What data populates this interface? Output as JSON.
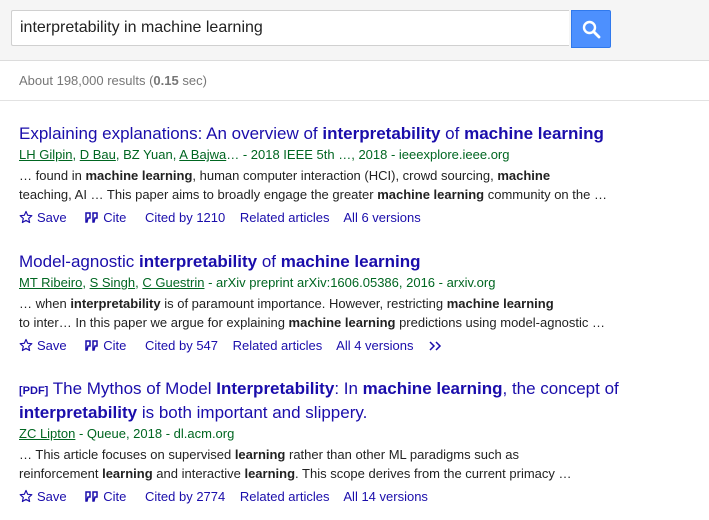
{
  "search": {
    "query": "interpretability in machine learning"
  },
  "stats": {
    "prefix": "About 198,000 results (",
    "time": "0.15",
    "suffix": " sec)"
  },
  "actions": {
    "save_label": "Save",
    "cite_label": "Cite",
    "related_label": "Related articles"
  },
  "results": [
    {
      "title_parts": [
        "Explaining explanations: An overview of ",
        "interpretability",
        " of ",
        "machine learning"
      ],
      "authors": [
        "LH Gilpin",
        "D Bau",
        "BZ Yuan",
        "A Bajwa"
      ],
      "meta_tail": "… - 2018 IEEE 5th …, 2018 - ieeexplore.ieee.org",
      "snippet_line1": [
        "… found in ",
        "machine learning",
        ", human computer interaction (HCI), crowd sourcing, ",
        "machine"
      ],
      "snippet_line2": [
        "teaching, AI … This paper aims to broadly engage the greater ",
        "machine learning",
        " community on the …"
      ],
      "cited_by": "Cited by 1210",
      "versions": "All 6 versions"
    },
    {
      "title_parts": [
        "Model-agnostic ",
        "interpretability",
        " of ",
        "machine learning"
      ],
      "authors": [
        "MT Ribeiro",
        "S Singh",
        "C Guestrin"
      ],
      "meta_tail": " - arXiv preprint arXiv:1606.05386, 2016 - arxiv.org",
      "snippet_line1": [
        "… when ",
        "interpretability",
        " is of paramount importance. However, restricting ",
        "machine learning"
      ],
      "snippet_line2": [
        "to inter… In this paper we argue for explaining ",
        "machine learning",
        " predictions using model-agnostic …"
      ],
      "cited_by": "Cited by 547",
      "versions": "All 4 versions"
    },
    {
      "pdf_tag": "[PDF]",
      "title_parts": [
        "The Mythos of Model ",
        "Interpretability",
        ": In ",
        "machine learning",
        ", the concept of ",
        "interpretability",
        " is both important and slippery."
      ],
      "authors": [
        "ZC Lipton"
      ],
      "meta_tail": " - Queue, 2018 - dl.acm.org",
      "snippet_line1": [
        "… This article focuses on supervised ",
        "learning",
        " rather than other ML paradigms such as"
      ],
      "snippet_line2": [
        "reinforcement ",
        "learning",
        " and interactive ",
        "learning",
        ". This scope derives from the current primacy …"
      ],
      "cited_by": "Cited by 2774",
      "versions": "All 14 versions"
    }
  ]
}
